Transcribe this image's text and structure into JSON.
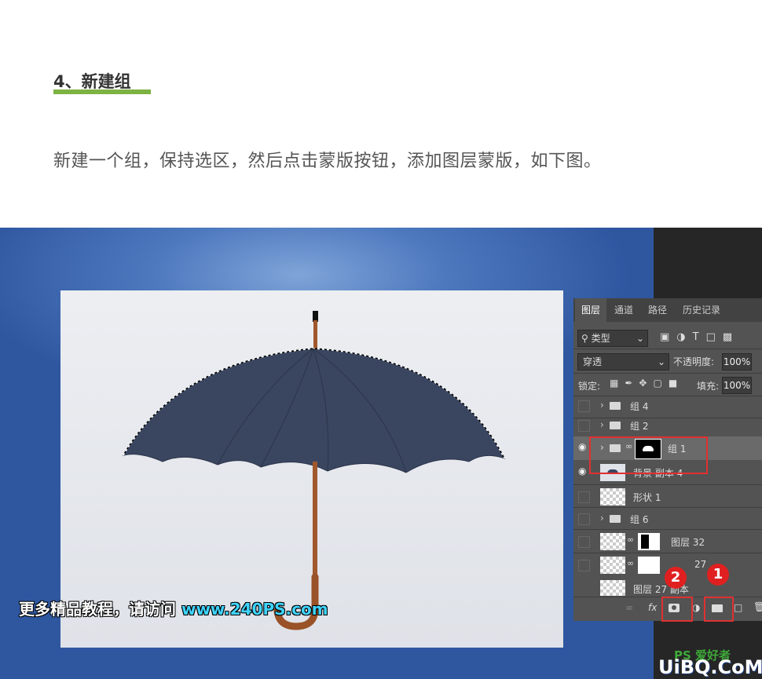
{
  "article": {
    "heading": "4、新建组",
    "paragraph": "新建一个组，保持选区，然后点击蒙版按钮，添加图层蒙版，如下图。"
  },
  "panel": {
    "tabs": [
      "图层",
      "通道",
      "路径",
      "历史记录"
    ],
    "filter_label": "类型",
    "blend_mode": "穿透",
    "opacity_label": "不透明度:",
    "opacity_value": "100%",
    "lock_label": "锁定:",
    "fill_label": "填充:",
    "fill_value": "100%",
    "layers": [
      {
        "name": "组 4",
        "kind": "group",
        "visible": false
      },
      {
        "name": "组 2",
        "kind": "group",
        "visible": false
      },
      {
        "name": "组 1",
        "kind": "group-mask",
        "visible": true,
        "selected": true
      },
      {
        "name": "背景 副本 4",
        "kind": "image",
        "visible": true
      },
      {
        "name": "形状 1",
        "kind": "shape",
        "visible": false
      },
      {
        "name": "组 6",
        "kind": "group",
        "visible": false
      },
      {
        "name": "图层 32",
        "kind": "mask",
        "visible": false
      },
      {
        "name": "27",
        "kind": "mask",
        "visible": false
      },
      {
        "name": "图层 27 副本",
        "kind": "image",
        "visible": false
      }
    ],
    "bottom_icons": [
      "link-icon",
      "fx-icon",
      "mask-icon",
      "adjustment-icon",
      "new-group-icon",
      "new-layer-icon",
      "delete-icon"
    ]
  },
  "annotations": {
    "badge1": "1",
    "badge2": "2"
  },
  "watermarks": {
    "promo_cn": "更多精品教程，请访问",
    "promo_url": "www.240PS.com",
    "ps_logo": "PS 爱好者",
    "uibq": "UiBQ.CoM"
  },
  "colors": {
    "accent_underline": "#7cb342",
    "highlight_red": "#e02020"
  }
}
